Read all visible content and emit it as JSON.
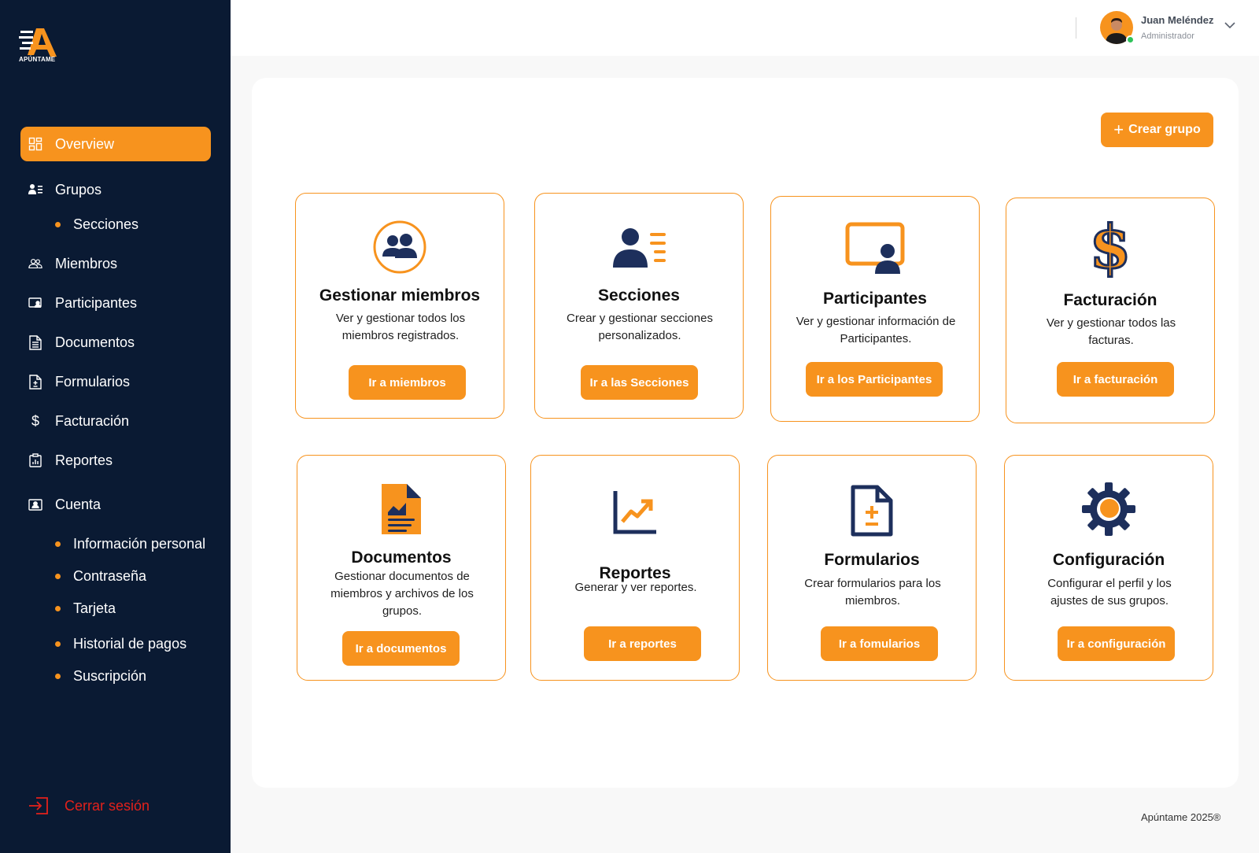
{
  "brand": {
    "name": "APÚNTAME",
    "accent": "#f7931e",
    "sidebar_bg": "#0a1a33",
    "logout_color": "#e3211b"
  },
  "sidebar": {
    "items": [
      {
        "label": "Overview",
        "icon": "dashboard-icon",
        "active": true
      },
      {
        "label": "Grupos",
        "icon": "group-list-icon"
      },
      {
        "label": "Miembros",
        "icon": "members-icon"
      },
      {
        "label": "Participantes",
        "icon": "participant-screen-icon"
      },
      {
        "label": "Documentos",
        "icon": "document-icon"
      },
      {
        "label": "Formularios",
        "icon": "form-icon"
      },
      {
        "label": "Facturación",
        "icon": "dollar-icon"
      },
      {
        "label": "Reportes",
        "icon": "report-icon"
      },
      {
        "label": "Cuenta",
        "icon": "account-card-icon"
      }
    ],
    "grupos_sub": [
      "Secciones"
    ],
    "cuenta_sub": [
      "Información personal",
      "Contraseña",
      "Tarjeta",
      "Historial de pagos",
      "Suscripción"
    ],
    "logout": "Cerrar sesión"
  },
  "header": {
    "user_name": "Juan Meléndez",
    "user_role": "Administrador"
  },
  "main": {
    "create_button": "Crear grupo",
    "cards": [
      {
        "title": "Gestionar miembros",
        "description": "Ver y gestionar todos los miembros registrados.",
        "button": "Ir a miembros",
        "icon": "members-circle-icon"
      },
      {
        "title": "Secciones",
        "description": "Crear y gestionar secciones personalizados.",
        "button": "Ir a las Secciones",
        "icon": "sections-list-icon"
      },
      {
        "title": "Participantes",
        "description": "Ver y gestionar información de Participantes.",
        "button": "Ir a los Participantes",
        "icon": "participant-screen-icon"
      },
      {
        "title": "Facturación",
        "description": "Ver y gestionar todos las facturas.",
        "button": "Ir a facturación",
        "icon": "dollar-icon"
      },
      {
        "title": "Documentos",
        "description": "Gestionar documentos de miembros y archivos de  los grupos.",
        "button": "Ir a documentos",
        "icon": "document-icon"
      },
      {
        "title": "Reportes",
        "description": "Generar y ver reportes.",
        "button": "Ir a reportes",
        "icon": "trend-chart-icon"
      },
      {
        "title": "Formularios",
        "description": "Crear formularios para los miembros.",
        "button": "Ir a fomularios",
        "icon": "form-icon"
      },
      {
        "title": "Configuración",
        "description": "Configurar el perfil y los ajustes de sus grupos.",
        "button": "Ir a configuración",
        "icon": "gear-icon"
      }
    ]
  },
  "footer": {
    "text": "Apúntame 2025®"
  }
}
